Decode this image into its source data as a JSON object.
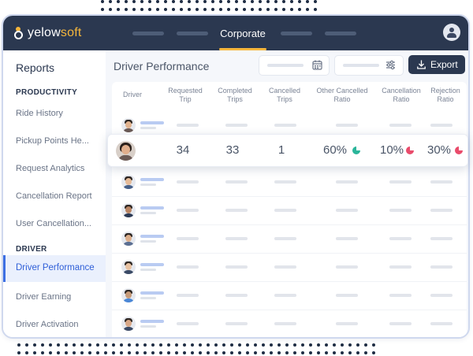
{
  "app": {
    "logo_text_a": "yelow",
    "logo_text_b": "soft",
    "active_tab": "Corporate"
  },
  "sidebar": {
    "title": "Reports",
    "sections": [
      {
        "label": "PRODUCTIVITY",
        "items": [
          "Ride History",
          "Pickup Points He...",
          "Request Analytics",
          "Cancellation Report",
          "User Cancellation..."
        ]
      },
      {
        "label": "DRIVER",
        "items": [
          "Driver Performance",
          "Driver Earning",
          "Driver Activation"
        ]
      }
    ],
    "active_item": "Driver Performance"
  },
  "main": {
    "page_title": "Driver Performance",
    "export_label": "Export",
    "columns": [
      "Driver",
      "Requested Trip",
      "Completed Trips",
      "Cancelled Trips",
      "Other Cancelled Ratio",
      "Cancellation Ratio",
      "Rejection Ratio"
    ],
    "highlighted_row": {
      "requested_trip": "34",
      "completed_trips": "33",
      "cancelled_trips": "1",
      "other_cancelled_ratio": "60%",
      "cancellation_ratio": "10%",
      "rejection_ratio": "30%"
    }
  },
  "colors": {
    "nav_bg": "#2b3850",
    "accent": "#f5b63c",
    "active_link": "#2f5fd8",
    "pie_green": "#2ab59a",
    "pie_red": "#e94b6b"
  },
  "icons": [
    "calendar-icon",
    "filter-sliders-icon",
    "download-icon",
    "user-icon",
    "pie-chart-icon"
  ]
}
